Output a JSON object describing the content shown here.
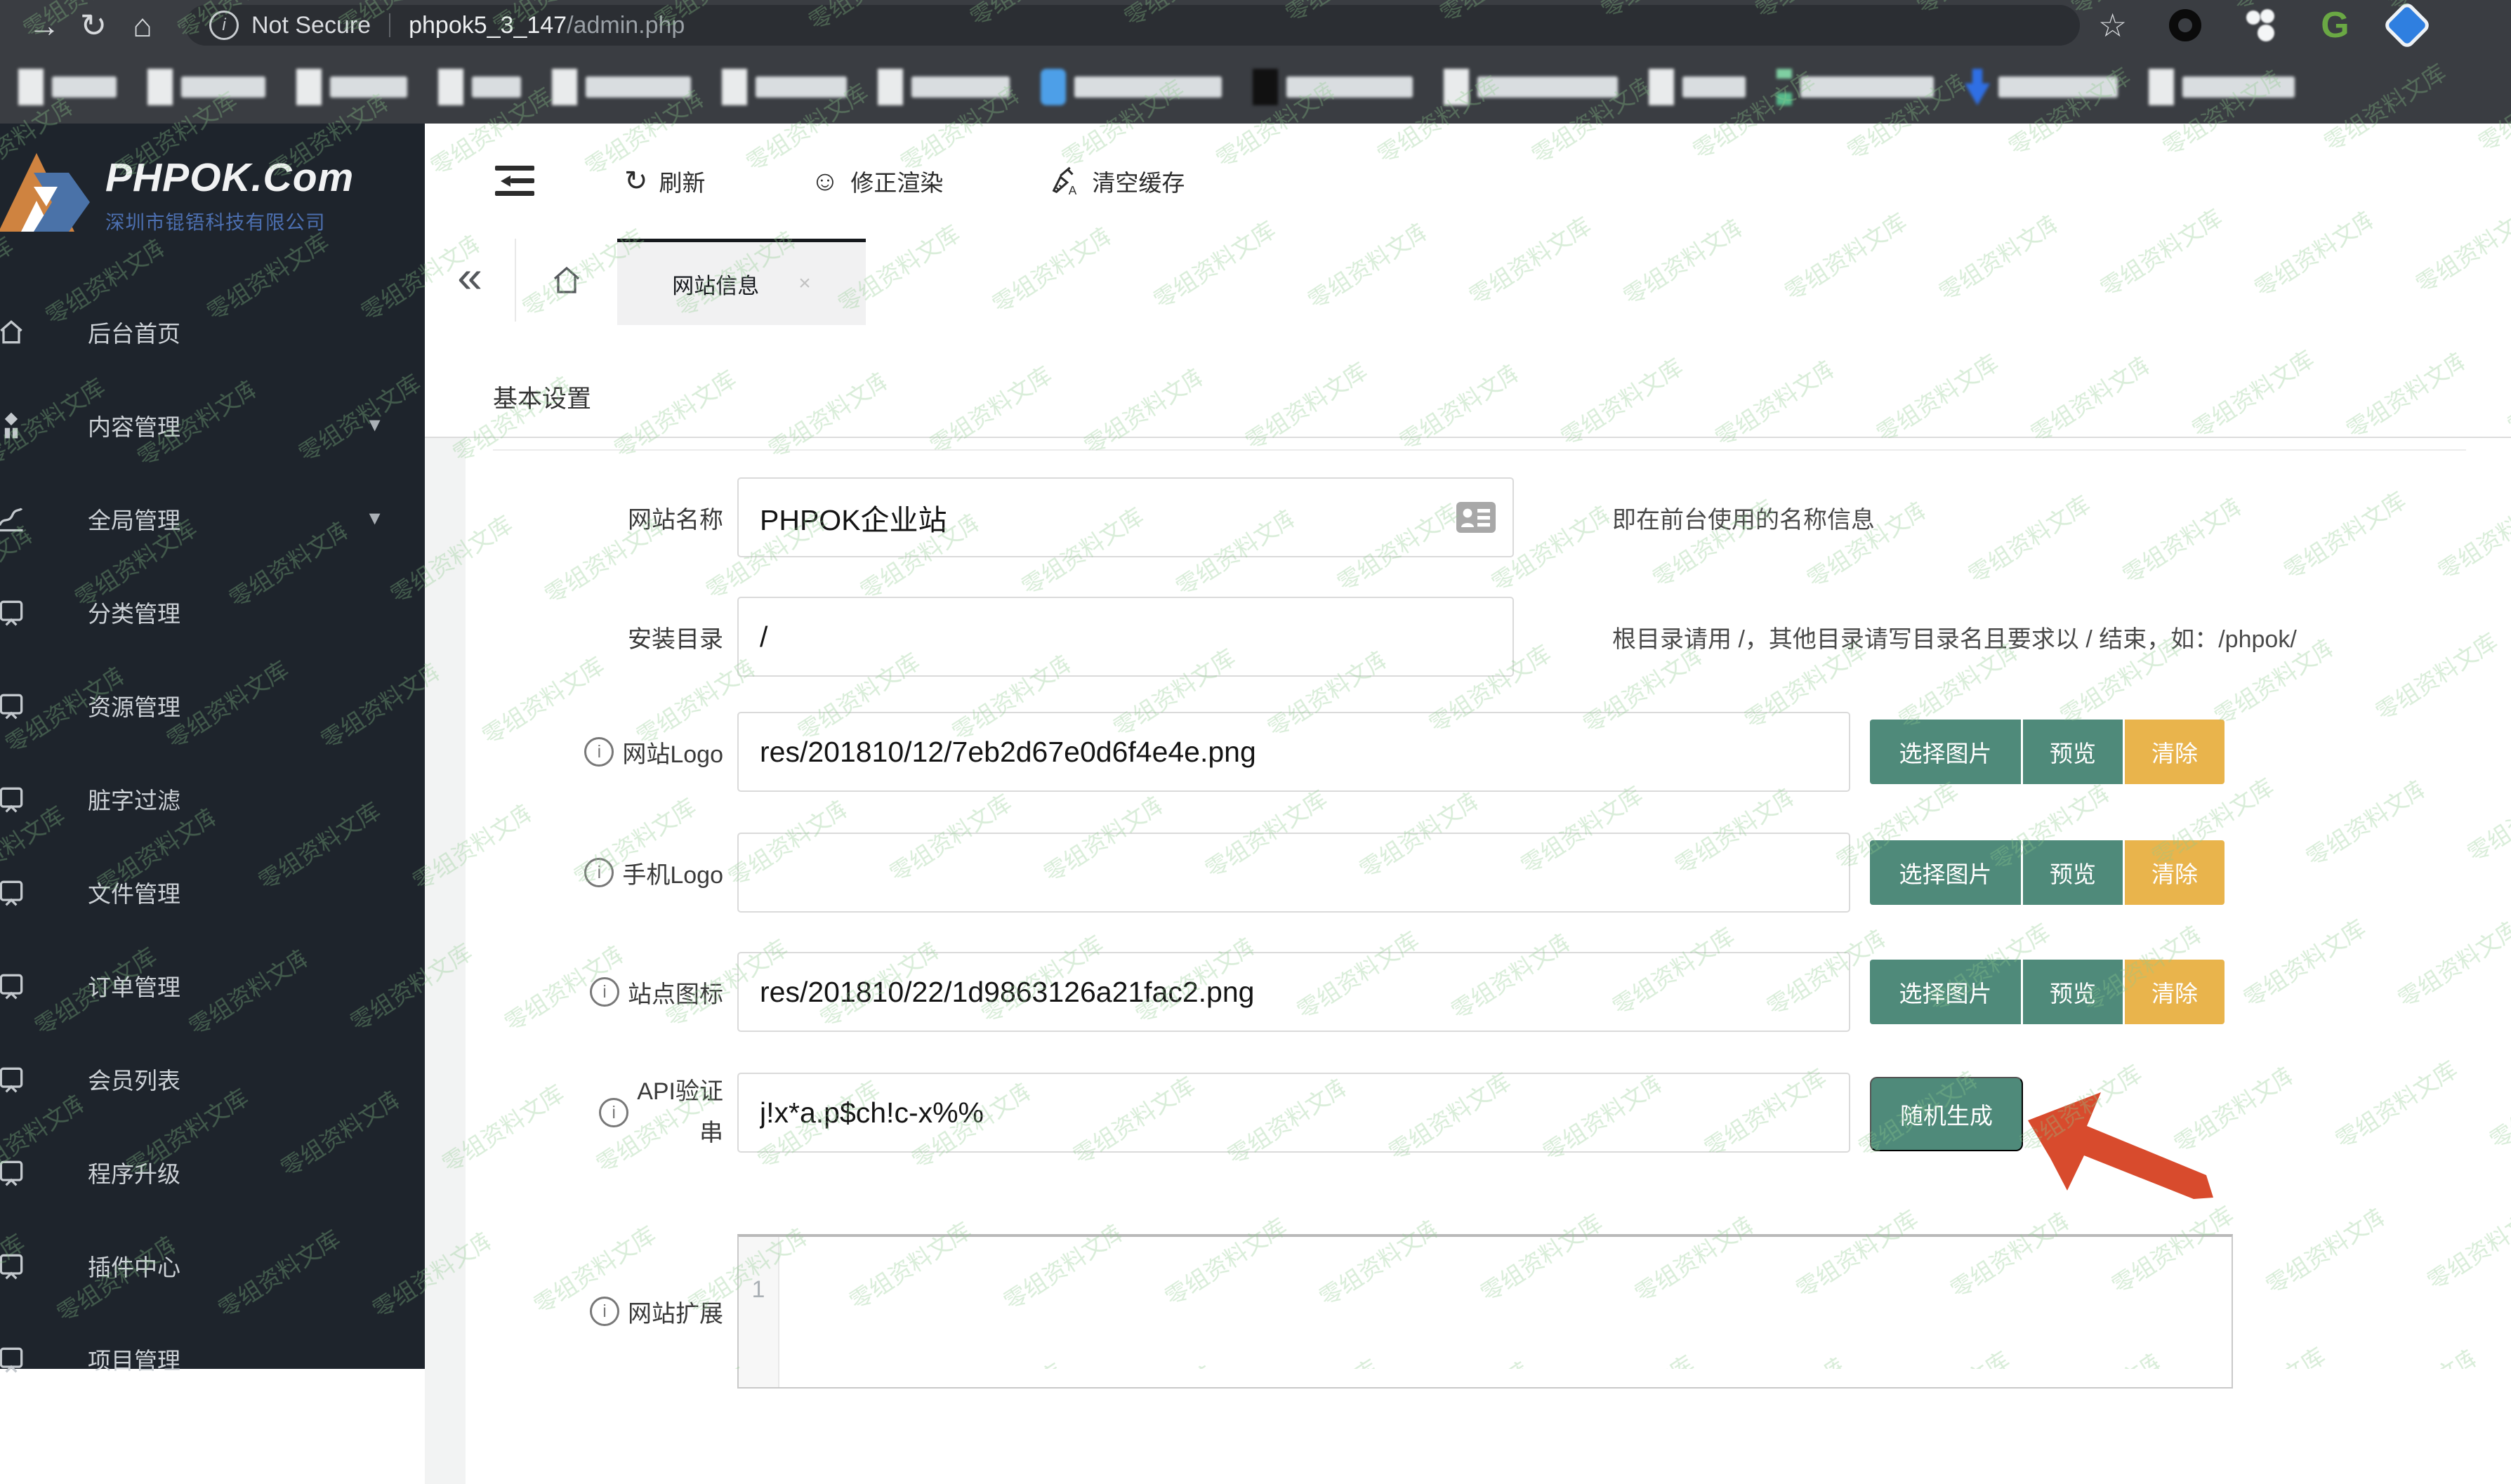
{
  "browser": {
    "security_label": "Not Secure",
    "url_host": "phpok5_3_147",
    "url_path": "/admin.php",
    "icons": [
      "forward-arrow",
      "reload",
      "home",
      "bookmark-star",
      "extension-circle",
      "extension-dots",
      "extension-g",
      "extension-gem"
    ]
  },
  "sidebar": {
    "logo_title": "PHPOK.Com",
    "logo_subtitle": "深圳市锟铻科技有限公司",
    "items": [
      {
        "label": "后台首页"
      },
      {
        "label": "内容管理"
      },
      {
        "label": "全局管理"
      },
      {
        "label": "分类管理"
      },
      {
        "label": "资源管理"
      },
      {
        "label": "脏字过滤"
      },
      {
        "label": "文件管理"
      },
      {
        "label": "订单管理"
      },
      {
        "label": "会员列表"
      },
      {
        "label": "程序升级"
      },
      {
        "label": "插件中心"
      },
      {
        "label": "项目管理"
      }
    ]
  },
  "toolbar": {
    "refresh_label": "刷新",
    "fix_render_label": "修正渲染",
    "clear_cache_label": "清空缓存"
  },
  "tabs": {
    "active_label": "网站信息"
  },
  "form": {
    "section_title": "基本设置",
    "site_name": {
      "label": "网站名称",
      "value": "PHPOK企业站",
      "help": "即在前台使用的名称信息"
    },
    "install_dir": {
      "label": "安装目录",
      "value": "/",
      "help": "根目录请用 /，其他目录请写目录名且要求以 / 结束，如：/phpok/"
    },
    "site_logo": {
      "label": "网站Logo",
      "value": "res/201810/12/7eb2d67e0d6f4e4e.png"
    },
    "mobile_logo": {
      "label": "手机Logo",
      "value": ""
    },
    "site_icon": {
      "label": "站点图标",
      "value": "res/201810/22/1d9863126a21fac2.png"
    },
    "api_token": {
      "label_line1": "API验证",
      "label_line2": "串",
      "value": "j!x*a.p$ch!c-x%%",
      "generate_label": "随机生成"
    },
    "site_ext": {
      "label": "网站扩展",
      "line_number": "1"
    },
    "buttons": {
      "choose": "选择图片",
      "preview": "预览",
      "clear": "清除"
    }
  },
  "watermark": {
    "text": "零组资料文库"
  },
  "colors": {
    "teal_button": "#4f8a7a",
    "orange_button": "#e9b44c",
    "red_arrow": "#d84b2d",
    "sidebar_bg": "#1e242c",
    "browser_bar_bg": "#3a3d42",
    "logo_subtitle_blue": "#4c6fb0",
    "watermark_green": "#8cc98c",
    "twitter_bookmark_blue": "#4d9fe8"
  }
}
